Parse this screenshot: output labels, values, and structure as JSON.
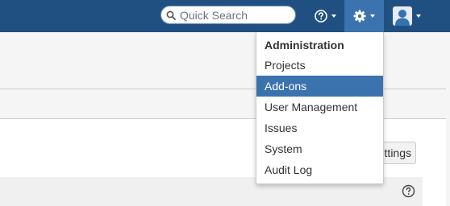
{
  "header": {
    "search": {
      "placeholder": "Quick Search",
      "value": ""
    },
    "help_icon": "question-circle-icon",
    "admin_icon": "gear-icon",
    "user_icon": "user-avatar-icon",
    "background_color": "#205081",
    "active_color": "#3b73af"
  },
  "admin_menu": {
    "heading": "Administration",
    "items": [
      {
        "label": "Projects",
        "active": false
      },
      {
        "label": "Add-ons",
        "active": true
      },
      {
        "label": "User Management",
        "active": false
      },
      {
        "label": "Issues",
        "active": false
      },
      {
        "label": "System",
        "active": false
      },
      {
        "label": "Audit Log",
        "active": false
      }
    ]
  },
  "page": {
    "settings_button_label": "ettings",
    "row_help_icon": "question-circle-icon"
  }
}
